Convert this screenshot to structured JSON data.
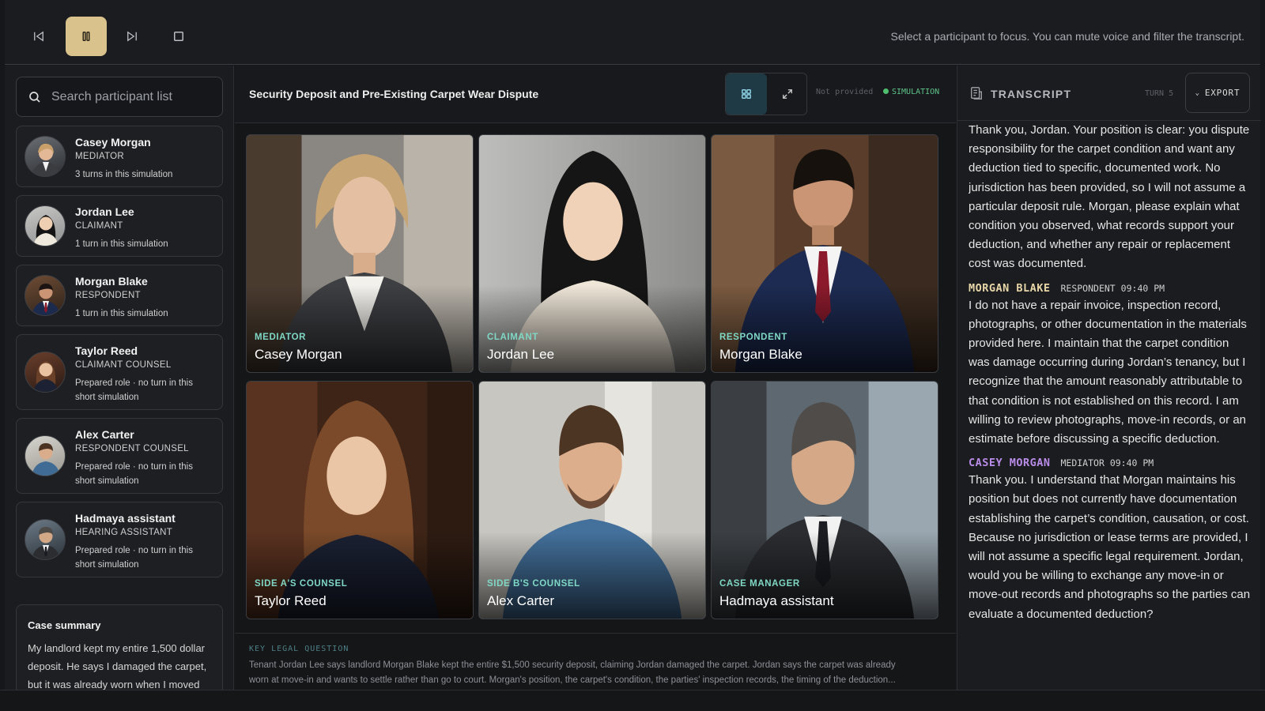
{
  "toolbar": {
    "hint": "Select a participant to focus. You can mute voice and filter the transcript.",
    "icons": [
      "skip-back-icon",
      "pause-icon",
      "skip-forward-icon",
      "stop-icon"
    ],
    "accent": "#d9c28c"
  },
  "sidebar": {
    "search_placeholder": "Search participant list",
    "participants": [
      {
        "name": "Casey Morgan",
        "role": "MEDIATOR",
        "turns": "3 turns in this simulation"
      },
      {
        "name": "Jordan Lee",
        "role": "CLAIMANT",
        "turns": "1 turn in this simulation"
      },
      {
        "name": "Morgan Blake",
        "role": "RESPONDENT",
        "turns": "1 turn in this simulation"
      },
      {
        "name": "Taylor Reed",
        "role": "CLAIMANT COUNSEL",
        "turns": "Prepared role · no turn in this short simulation"
      },
      {
        "name": "Alex Carter",
        "role": "RESPONDENT COUNSEL",
        "turns": "Prepared role · no turn in this short simulation"
      },
      {
        "name": "Hadmaya assistant",
        "role": "HEARING ASSISTANT",
        "turns": "Prepared role · no turn in this short simulation"
      }
    ],
    "summary": {
      "title": "Case summary",
      "text": "My landlord kept my entire 1,500 dollar deposit. He says I damaged the carpet, but it was already worn when I moved"
    }
  },
  "center": {
    "title": "Security Deposit and Pre-Existing Carpet Wear Dispute",
    "jurisdiction": "Not provided",
    "mode": "SIMULATION",
    "mode_color": "#4fbf6f",
    "view_icons": [
      "grid-view-icon",
      "expand-icon"
    ],
    "tiles": [
      {
        "role": "MEDIATOR",
        "name": "Casey Morgan"
      },
      {
        "role": "CLAIMANT",
        "name": "Jordan Lee"
      },
      {
        "role": "RESPONDENT",
        "name": "Morgan Blake"
      },
      {
        "role": "SIDE A'S COUNSEL",
        "name": "Taylor Reed"
      },
      {
        "role": "SIDE B'S COUNSEL",
        "name": "Alex Carter"
      },
      {
        "role": "CASE MANAGER",
        "name": "Hadmaya assistant"
      }
    ],
    "key_question": {
      "label": "KEY LEGAL QUESTION",
      "line1": "Tenant Jordan Lee says landlord Morgan Blake kept the entire $1,500 security deposit, claiming Jordan damaged the carpet. Jordan says the carpet was already",
      "line2": "worn at move-in and wants to settle rather than go to court. Morgan's position, the carpet's condition, the parties' inspection records, the timing of the deduction..."
    }
  },
  "transcript": {
    "title": "TRANSCRIPT",
    "turn": "TURN 5",
    "export": "EXPORT",
    "intro": "Thank you, Jordan. Your position is clear: you dispute responsibility for the carpet condition and want any deduction tied to specific, documented work. No jurisdiction has been provided, so I will not assume a particular deposit rule. Morgan, please explain what condition you observed, what records support your deduction, and whether any repair or replacement cost was documented.",
    "messages": [
      {
        "speaker": "MORGAN BLAKE",
        "role": "RESPONDENT",
        "time": "09:40 PM",
        "text": "I do not have a repair invoice, inspection record, photographs, or other documentation in the materials provided here. I maintain that the carpet condition was damage occurring during Jordan’s tenancy, but I recognize that the amount reasonably attributable to that condition is not established on this record. I am willing to review photographs, move-in records, or an estimate before discussing a specific deduction."
      },
      {
        "speaker": "CASEY MORGAN",
        "role": "MEDIATOR",
        "time": "09:40 PM",
        "text": "Thank you. I understand that Morgan maintains his position but does not currently have documentation establishing the carpet’s condition, causation, or cost. Because no jurisdiction or lease terms are provided, I will not assume a specific legal requirement. Jordan, would you be willing to exchange any move-in or move-out records and photographs so the parties can evaluate a documented deduction?"
      }
    ]
  }
}
